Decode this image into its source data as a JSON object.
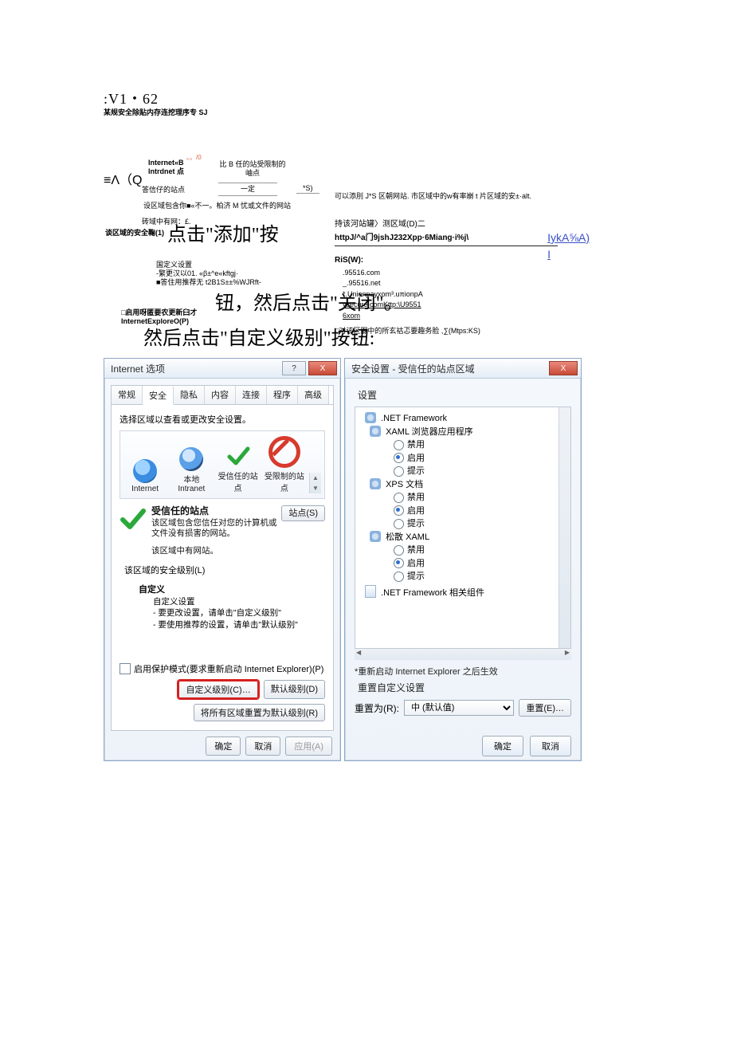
{
  "header": {
    "version": ":V1・62",
    "sub": "某规安全除贴内存连挖理序专 SJ"
  },
  "top": {
    "t1": "≡Λ（Q",
    "t2": "Internet«B\nIntrdnet 点",
    "t3": "比 B 任的站受限制的岫点",
    "t4": "答信仔的站点",
    "t5": "一定",
    "t6": "*S)",
    "t7": "设区域包含你■«不一。柏济 M 忧或文件的网站",
    "t8": "砖域中有网：£.",
    "t9": "谈区域的安全鞠(1)",
    "t10": "国定义设置\n-繁更汉以01. «β±^e«kftgj·\n■答住用推荐无 t2B1S±±%WJRft-",
    "t11": "□启用呀匿要农更新臼才\nInternetExploreO(P)",
    "t12": "。。/0"
  },
  "ann": {
    "line1": "点击\"添加\"按",
    "line2": "钮，然后点击\"关闭\"。",
    "line3": "然后点击\"自定义级别\"按钮:"
  },
  "right": {
    "intro": "可以添刖 J*S 区朝网站. 市区域中的w有率崩 t 片区域的安±·alt.",
    "zone_label": "持该河站罐〉测区域(D)二",
    "url": "httpJ/^a门9jshJ232Xpp·6Miang·i%j\\",
    "add": "IykA⅝A)",
    "add2": "I",
    "ris": "RiS(W):",
    "items": [
      ".95516.com",
      "_.95516.net",
      "*.Unionpayxom³.uπionpA",
      "ysecure.comKttp:\\U9551",
      "6xom"
    ],
    "foot": "□对该区脲中的所玄祜忑要趣务脸 ,∑(Mtps:KS)"
  },
  "dlgL": {
    "title": "Internet 选项",
    "tabs": [
      "常规",
      "安全",
      "隐私",
      "内容",
      "连接",
      "程序",
      "高级"
    ],
    "select_zone": "选择区域以查看或更改安全设置。",
    "zones": [
      "Internet",
      "本地\nIntranet",
      "受信任的站点",
      "受限制的站点"
    ],
    "trusted_title": "受信任的站点",
    "sites_btn": "站点(S)",
    "trusted_desc": "该区域包含您信任对您的计算机或文件没有损害的网站。",
    "has_sites": "该区域中有网站。",
    "lvl_label": "该区域的安全级别(L)",
    "lvl_custom": "自定义",
    "lvl_sub": "自定义设置",
    "lvl_b1": "- 要更改设置，请单击\"自定义级别\"",
    "lvl_b2": "- 要使用推荐的设置，请单击\"默认级别\"",
    "chk": "启用保护模式(要求重新启动 Internet Explorer)(P)",
    "btn_custom": "自定义级别(C)…",
    "btn_default": "默认级别(D)",
    "btn_reset_all": "将所有区域重置为默认级别(R)",
    "ok": "确定",
    "cancel": "取消",
    "apply": "应用(A)"
  },
  "dlgR": {
    "title": "安全设置 - 受信任的站点区域",
    "group": "设置",
    "tree": {
      "n1": ".NET Framework",
      "n2": "XAML 浏览器应用程序",
      "opts": [
        "禁用",
        "启用",
        "提示"
      ],
      "n3": "XPS 文档",
      "n4": "松散 XAML",
      "n5": ".NET Framework 相关组件"
    },
    "note": "*重新启动 Internet Explorer 之后生效",
    "reset_lbl": "重置自定义设置",
    "reset_to": "重置为(R):",
    "reset_val": "中 (默认值)",
    "reset_btn": "重置(E)…",
    "ok": "确定",
    "cancel": "取消"
  }
}
